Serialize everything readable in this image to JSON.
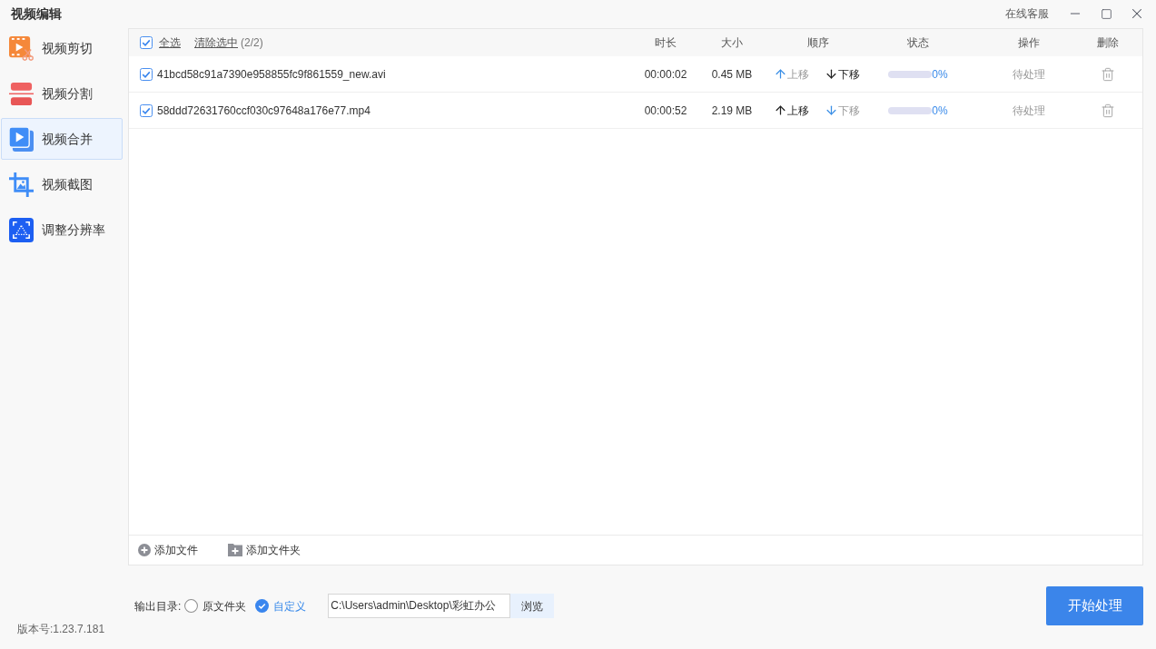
{
  "window": {
    "title": "视频编辑",
    "support_link": "在线客服"
  },
  "sidebar": {
    "items": [
      {
        "label": "视频剪切",
        "kind": "cut",
        "selected": false
      },
      {
        "label": "视频分割",
        "kind": "split",
        "selected": false
      },
      {
        "label": "视频合并",
        "kind": "merge",
        "selected": true
      },
      {
        "label": "视频截图",
        "kind": "screenshot",
        "selected": false
      },
      {
        "label": "调整分辨率",
        "kind": "resolution",
        "selected": false
      }
    ],
    "version": "版本号:1.23.7.181"
  },
  "file_list": {
    "select_all": {
      "label": "全选",
      "checked": true
    },
    "clear_selection": "清除选中",
    "selection_count": "(2/2)",
    "columns": [
      "时长",
      "大小",
      "顺序",
      "状态",
      "操作",
      "删除"
    ],
    "rows": [
      {
        "checked": true,
        "name": "41bcd58c91a7390e958855fc9f861559_new.avi",
        "duration": "00:00:02",
        "size": "0.45 MB",
        "move_up": {
          "label": "上移",
          "disabled": true
        },
        "move_down": {
          "label": "下移",
          "disabled": false
        },
        "level": 0,
        "progress": "0%",
        "action": "待处理"
      },
      {
        "checked": true,
        "name": "58ddd72631760ccf030c97648a176e77.mp4",
        "duration": "00:00:52",
        "size": "2.19 MB",
        "move_up": {
          "label": "上移",
          "disabled": false
        },
        "move_down": {
          "label": "下移",
          "disabled": true
        },
        "level": 0,
        "progress": "0%",
        "action": "待处理"
      }
    ],
    "toolbar": [
      {
        "label": "添加文件",
        "kind": "file"
      },
      {
        "label": "添加文件夹",
        "kind": "folder"
      }
    ]
  },
  "output": {
    "label": "输出目录:",
    "options": [
      {
        "label": "原文件夹",
        "selected": false
      },
      {
        "label": "自定义",
        "selected": true
      }
    ],
    "path": "C:\\Users\\admin\\Desktop\\彩虹办公",
    "browse": "浏览"
  },
  "start_button": "开始处理"
}
